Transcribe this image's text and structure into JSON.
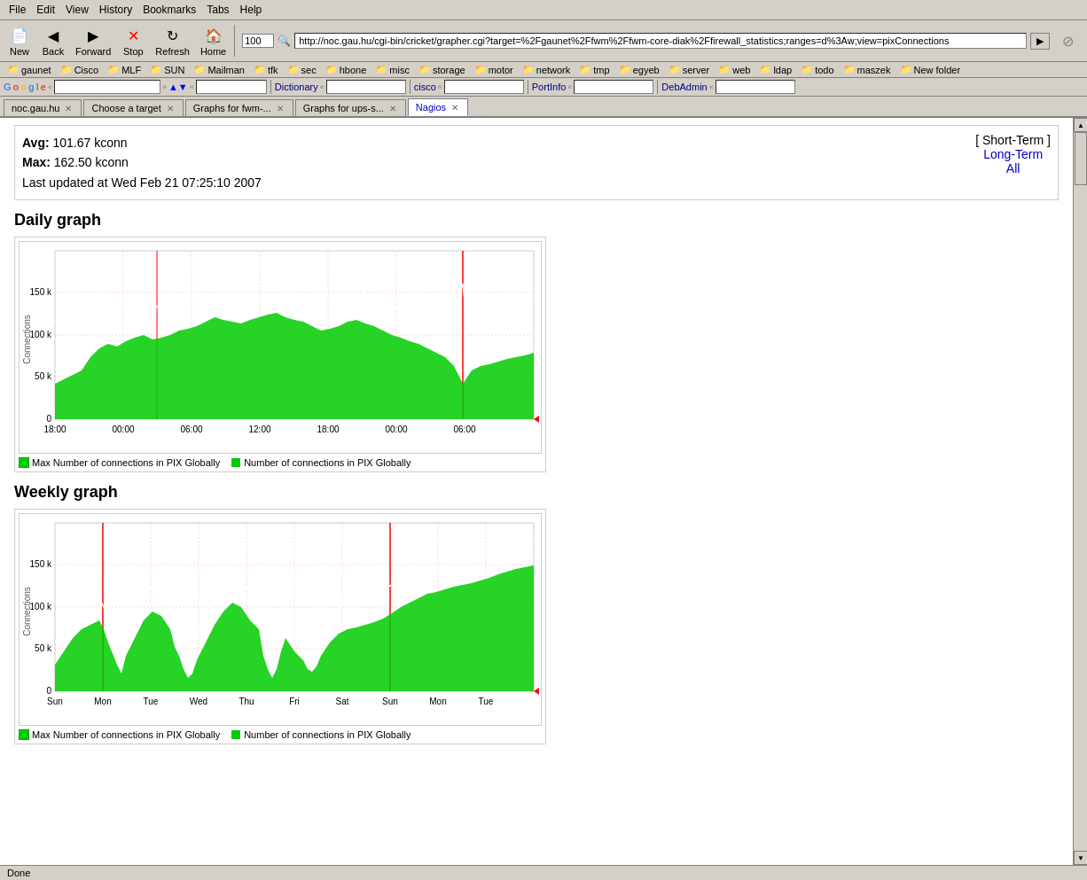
{
  "menubar": {
    "items": [
      "File",
      "Edit",
      "View",
      "History",
      "Bookmarks",
      "Tabs",
      "Help"
    ]
  },
  "toolbar": {
    "new_label": "New",
    "back_label": "Back",
    "forward_label": "Forward",
    "stop_label": "Stop",
    "refresh_label": "Refresh",
    "home_label": "Home",
    "zoom_value": "100",
    "url_value": "http://noc.gau.hu/cgi-bin/cricket/grapher.cgi?target=%2Fgaunet%2Ffwm%2Ffwm-core-diak%2Ffirewall_statistics;ranges=d%3Aw;view=pixConnections"
  },
  "bookmarks": {
    "items": [
      "gaunet",
      "Cisco",
      "MLF",
      "SUN",
      "Mailman",
      "tfk",
      "sec",
      "hbone",
      "misc",
      "storage",
      "motor",
      "network",
      "tmp",
      "egyeb",
      "server",
      "web",
      "ldap",
      "todo",
      "maszek",
      "New folder"
    ]
  },
  "searchbar": {
    "google_label": "Google",
    "dictionary_label": "Dictionary",
    "cisco_label": "cisco",
    "portinfo_label": "PortInfo",
    "debadmin_label": "DebAdmin"
  },
  "tabs": {
    "items": [
      {
        "label": "noc.gau.hu",
        "closable": true,
        "active": false
      },
      {
        "label": "Choose a target",
        "closable": true,
        "active": false
      },
      {
        "label": "Graphs for fwm-...",
        "closable": true,
        "active": false
      },
      {
        "label": "Graphs for ups-s...",
        "closable": true,
        "active": false
      },
      {
        "label": "Nagios",
        "closable": true,
        "active": true
      }
    ]
  },
  "page": {
    "short_term_label": "[ Short-Term ]",
    "long_term_label": "Long-Term",
    "all_label": "All",
    "avg_label": "Avg:",
    "avg_value": "101.67 kconn",
    "max_label": "Max:",
    "max_value": "162.50 kconn",
    "last_updated": "Last updated at Wed Feb 21 07:25:10 2007",
    "daily_graph_title": "Daily graph",
    "weekly_graph_title": "Weekly graph",
    "legend_max_label": "Max Number of connections in PIX Globally",
    "legend_cur_label": "Number of connections in PIX Globally",
    "daily_y_labels": [
      "150 k",
      "100 k",
      "50 k",
      "0"
    ],
    "daily_x_labels": [
      "18:00",
      "00:00",
      "06:00",
      "12:00",
      "18:00",
      "00:00",
      "06:00"
    ],
    "weekly_y_labels": [
      "150 k",
      "100 k",
      "50 k",
      "0"
    ],
    "weekly_x_labels": [
      "Sun",
      "Mon",
      "Tue",
      "Wed",
      "Thu",
      "Fri",
      "Sat",
      "Sun",
      "Mon",
      "Tue"
    ]
  }
}
